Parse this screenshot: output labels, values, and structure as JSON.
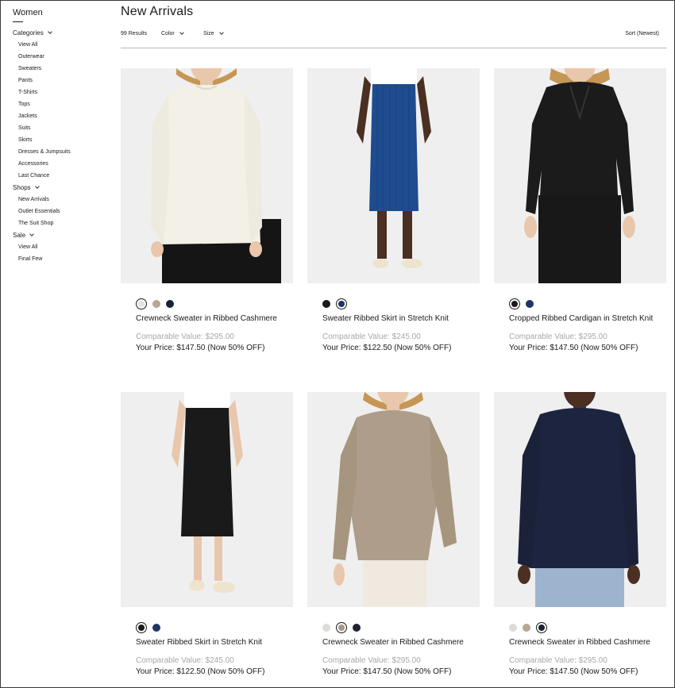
{
  "sidebar": {
    "title": "Women",
    "groups": [
      {
        "label": "Categories",
        "items": [
          "View All",
          "Outerwear",
          "Sweaters",
          "Pants",
          "T-Shirts",
          "Tops",
          "Jackets",
          "Suits",
          "Skirts",
          "Dresses & Jumpsuits",
          "Accessories",
          "Last Chance"
        ]
      },
      {
        "label": "Shops",
        "items": [
          "New Arrivals",
          "Outlet Essentials",
          "The Suit Shop"
        ]
      },
      {
        "label": "Sale",
        "items": [
          "View All",
          "Final Few"
        ]
      }
    ]
  },
  "header": {
    "title": "New Arrivals",
    "results": "99 Results",
    "color_filter": "Color",
    "size_filter": "Size",
    "sort": "Sort (Newest)"
  },
  "products": [
    {
      "name": "Crewneck Sweater in Ribbed Cashmere",
      "compare": "Comparable Value: $295.00",
      "price": "Your Price: $147.50 (Now 50% OFF)",
      "garment": "sweater-white",
      "swatches": [
        {
          "color": "#e2e2e2",
          "selected": true
        },
        {
          "color": "#b9a693",
          "selected": false
        },
        {
          "color": "#1c2233",
          "selected": false
        }
      ]
    },
    {
      "name": "Sweater Ribbed Skirt in Stretch Knit",
      "compare": "Comparable Value: $245.00",
      "price": "Your Price: $122.50 (Now 50% OFF)",
      "garment": "skirt-blue",
      "swatches": [
        {
          "color": "#1a1a1a",
          "selected": false
        },
        {
          "color": "#1e3566",
          "selected": true
        }
      ]
    },
    {
      "name": "Cropped Ribbed Cardigan in Stretch Knit",
      "compare": "Comparable Value: $295.00",
      "price": "Your Price: $147.50 (Now 50% OFF)",
      "garment": "cardigan-black",
      "swatches": [
        {
          "color": "#1a1a1a",
          "selected": true
        },
        {
          "color": "#1e3566",
          "selected": false
        }
      ]
    },
    {
      "name": "Sweater Ribbed Skirt in Stretch Knit",
      "compare": "Comparable Value: $245.00",
      "price": "Your Price: $122.50 (Now 50% OFF)",
      "garment": "skirt-black",
      "swatches": [
        {
          "color": "#1a1a1a",
          "selected": true
        },
        {
          "color": "#1e3566",
          "selected": false
        }
      ]
    },
    {
      "name": "Crewneck Sweater in Ribbed Cashmere",
      "compare": "Comparable Value: $295.00",
      "price": "Your Price: $147.50 (Now 50% OFF)",
      "garment": "sweater-taupe",
      "swatches": [
        {
          "color": "#dcdcd6",
          "selected": false
        },
        {
          "color": "#a89684",
          "selected": true
        },
        {
          "color": "#1c2233",
          "selected": false
        }
      ]
    },
    {
      "name": "Crewneck Sweater in Ribbed Cashmere",
      "compare": "Comparable Value: $295.00",
      "price": "Your Price: $147.50 (Now 50% OFF)",
      "garment": "sweater-navy",
      "swatches": [
        {
          "color": "#dcdcd6",
          "selected": false
        },
        {
          "color": "#b9a693",
          "selected": false
        },
        {
          "color": "#1c2233",
          "selected": true
        }
      ]
    }
  ]
}
